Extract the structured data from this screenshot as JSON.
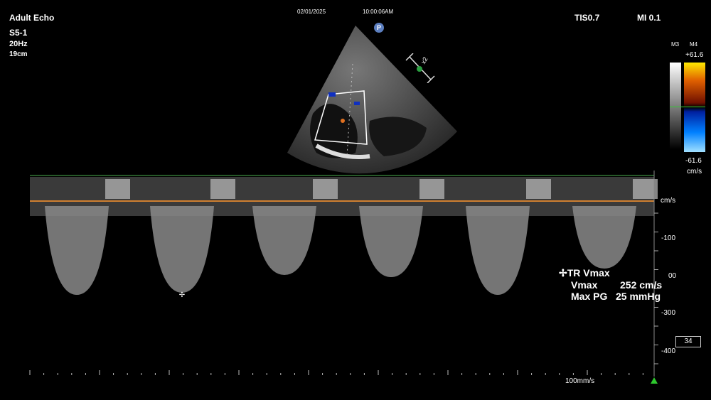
{
  "header": {
    "mode": "Adult Echo",
    "probe": "S5-1",
    "frame_rate": "20Hz",
    "depth": "19cm",
    "date": "02/01/2025",
    "time": "10:00:06AM",
    "tis": "TIS0.7",
    "mi": "MI 0.1"
  },
  "colormap": {
    "m3_label": "M3",
    "m4_label": "M4",
    "max_label": "+61.6",
    "min_label": "-61.6",
    "unit_label": "cm/s"
  },
  "sector": {
    "p_badge": "P",
    "zoom_label": "x2"
  },
  "doppler": {
    "unit_label": "cm/s",
    "scale_labels": [
      "-100",
      "00",
      "-300",
      "-400"
    ],
    "sweep_speed": "100mm/s",
    "box_value": "34"
  },
  "measurement": {
    "title": "TR Vmax",
    "vmax_label": "Vmax",
    "vmax_value": "252 cm/s",
    "pg_label": "Max PG",
    "pg_value": "25 mmHg"
  },
  "colors": {
    "baseline": "#d08030",
    "top_line": "#4caf50",
    "spectrum": "#cfcfcf"
  }
}
